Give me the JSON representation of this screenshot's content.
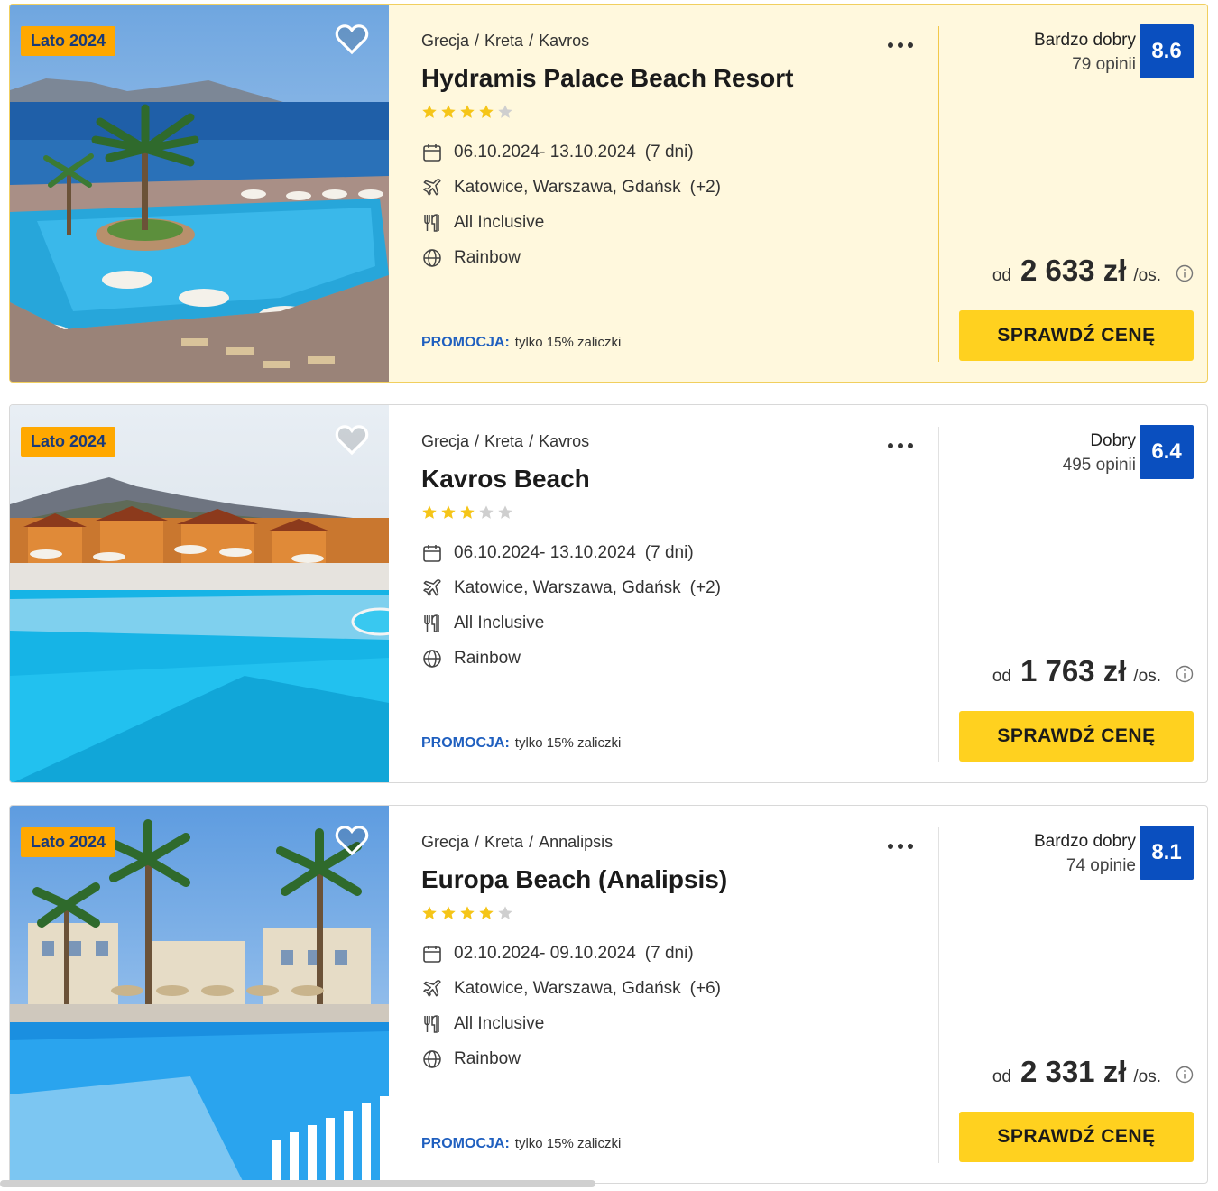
{
  "offers": [
    {
      "season_badge": "Lato 2024",
      "highlighted": true,
      "breadcrumb": [
        "Grecja",
        "Kreta",
        "Kavros"
      ],
      "hotel_name": "Hydramis Palace Beach Resort",
      "stars_filled": 4,
      "stars_total": 5,
      "dates": "06.10.2024- 13.10.2024",
      "duration": "(7 dni)",
      "departures": "Katowice, Warszawa, Gdańsk",
      "departures_more": "(+2)",
      "board": "All Inclusive",
      "operator": "Rainbow",
      "promo_label": "PROMOCJA:",
      "promo_text": "tylko 15% zaliczki",
      "rating_label": "Bardzo dobry",
      "rating_count": "79 opinii",
      "rating_score": "8.6",
      "price_prefix": "od",
      "price_amount": "2 633 zł",
      "price_suffix": "/os.",
      "cta_label": "SPRAWDŹ CENĘ",
      "photo_scene": "sea-pool"
    },
    {
      "season_badge": "Lato 2024",
      "highlighted": false,
      "breadcrumb": [
        "Grecja",
        "Kreta",
        "Kavros"
      ],
      "hotel_name": "Kavros Beach",
      "stars_filled": 3,
      "stars_total": 5,
      "dates": "06.10.2024- 13.10.2024",
      "duration": "(7 dni)",
      "departures": "Katowice, Warszawa, Gdańsk",
      "departures_more": "(+2)",
      "board": "All Inclusive",
      "operator": "Rainbow",
      "promo_label": "PROMOCJA:",
      "promo_text": "tylko 15% zaliczki",
      "rating_label": "Dobry",
      "rating_count": "495 opinii",
      "rating_score": "6.4",
      "price_prefix": "od",
      "price_amount": "1 763 zł",
      "price_suffix": "/os.",
      "cta_label": "SPRAWDŹ CENĘ",
      "photo_scene": "mountain-pool"
    },
    {
      "season_badge": "Lato 2024",
      "highlighted": false,
      "breadcrumb": [
        "Grecja",
        "Kreta",
        "Annalipsis"
      ],
      "hotel_name": "Europa Beach (Analipsis)",
      "stars_filled": 4,
      "stars_total": 5,
      "dates": "02.10.2024- 09.10.2024",
      "duration": "(7 dni)",
      "departures": "Katowice, Warszawa, Gdańsk",
      "departures_more": "(+6)",
      "board": "All Inclusive",
      "operator": "Rainbow",
      "promo_label": "PROMOCJA:",
      "promo_text": "tylko 15% zaliczki",
      "rating_label": "Bardzo dobry",
      "rating_count": "74 opinie",
      "rating_score": "8.1",
      "price_prefix": "od",
      "price_amount": "2 331 zł",
      "price_suffix": "/os.",
      "cta_label": "SPRAWDŹ CENĘ",
      "photo_scene": "palm-pool"
    }
  ],
  "icons": {
    "dates": "calendar-icon",
    "departures": "plane-icon",
    "board": "cutlery-icon",
    "operator": "globe-icon",
    "favourite": "heart-icon",
    "more": "more-dots-icon",
    "price_info": "info-icon"
  },
  "colors": {
    "badge": "#ffa800",
    "score": "#0a4fbf",
    "cta": "#ffd11f",
    "promo": "#1f5fbf",
    "star": "#f5c518",
    "highlight_bg": "#fff8dd"
  }
}
